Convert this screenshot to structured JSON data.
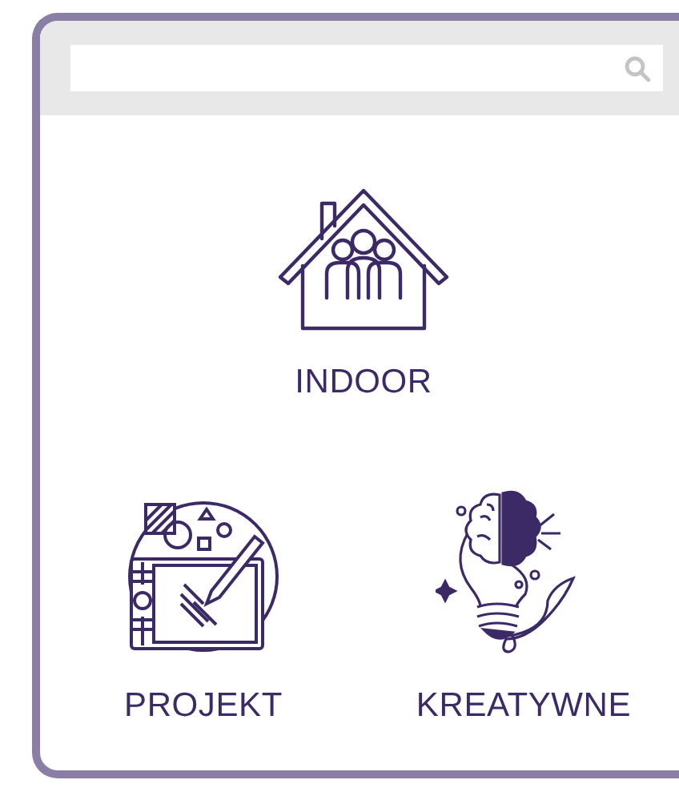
{
  "categories": [
    {
      "label": "INDOOR",
      "kind": "house"
    },
    {
      "label": "PROJEKT",
      "kind": "tablet"
    },
    {
      "label": "KREATYWNE",
      "kind": "bulb"
    }
  ]
}
